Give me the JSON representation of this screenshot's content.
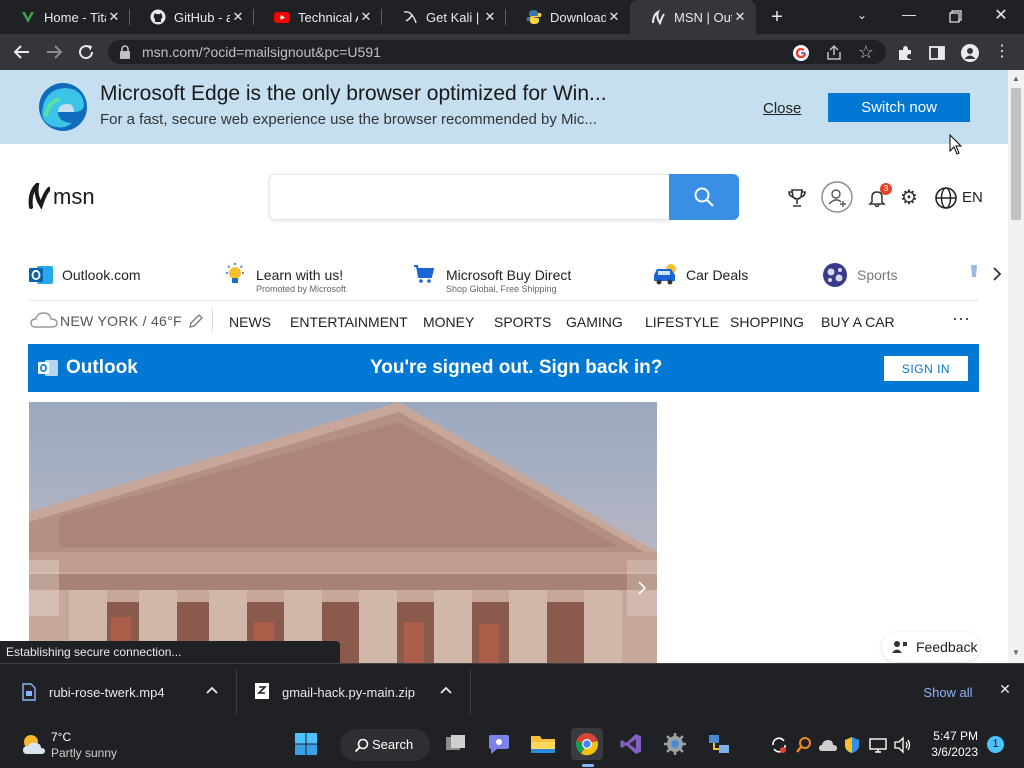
{
  "tabs": [
    {
      "label": "Home - Tita",
      "icon": "vee-icon"
    },
    {
      "label": "GitHub - ak",
      "icon": "github-icon"
    },
    {
      "label": "Technical A",
      "icon": "youtube-icon"
    },
    {
      "label": "Get Kali | K",
      "icon": "kali-icon"
    },
    {
      "label": "Download",
      "icon": "python-icon"
    },
    {
      "label": "MSN | Outl",
      "icon": "msn-icon"
    }
  ],
  "address": {
    "url": "msn.com/?ocid=mailsignout&pc=U591"
  },
  "banner": {
    "title": "Microsoft Edge is the only browser optimized for Win...",
    "subtitle": "For a fast, secure web experience use the browser recommended by Mic...",
    "close": "Close",
    "switch": "Switch now"
  },
  "msn": {
    "logo": "msn",
    "lang": "EN",
    "notif_count": "3"
  },
  "quicklinks": [
    {
      "label": "Outlook.com",
      "sub": ""
    },
    {
      "label": "Learn with us!",
      "sub": "Promoted by Microsoft"
    },
    {
      "label": "Microsoft Buy Direct",
      "sub": "Shop Global, Free Shipping"
    },
    {
      "label": "Car Deals",
      "sub": ""
    },
    {
      "label": "Sports",
      "sub": ""
    }
  ],
  "weather": "NEW YORK / 46°F",
  "nav": [
    "NEWS",
    "ENTERTAINMENT",
    "MONEY",
    "SPORTS",
    "GAMING",
    "LIFESTYLE",
    "SHOPPING",
    "BUY A CAR"
  ],
  "more": "···",
  "outlook_bar": {
    "brand": "Outlook",
    "message": "You're signed out. Sign back in?",
    "signin": "SIGN IN"
  },
  "feedback": "Feedback",
  "status": "Establishing secure connection...",
  "downloads": {
    "items": [
      {
        "name": "rubi-rose-twerk.mp4"
      },
      {
        "name": "gmail-hack.py-main.zip"
      }
    ],
    "show_all": "Show all"
  },
  "taskbar": {
    "temp": "7°C",
    "condition": "Partly sunny",
    "search": "Search",
    "time": "5:47 PM",
    "date": "3/6/2023",
    "badge": "1"
  },
  "colors": {
    "outlook_blue": "#0078d4",
    "banner_bg": "#c5dff0",
    "chrome_dark": "#202124"
  }
}
